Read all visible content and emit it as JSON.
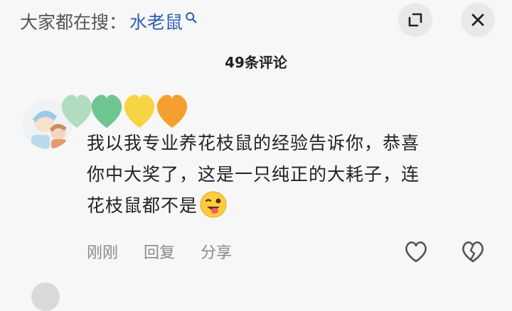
{
  "search": {
    "prefix": "大家都在搜：",
    "term": "水老鼠",
    "icon": "search-icon"
  },
  "header": {
    "expand_icon": "expand-icon",
    "close_icon": "close-icon"
  },
  "comments_header": {
    "count_label": "49条评论"
  },
  "comment": {
    "avatar_icon": "avatar",
    "heart_colors": [
      "#a8d8b9",
      "#66c28a",
      "#f5d23a",
      "#f59a23"
    ],
    "lines": [
      "我以我专业养花枝鼠的经验告诉你，恭喜",
      "你中大奖了，这是一只纯正的大耗子，连",
      "花枝鼠都不是"
    ],
    "emoji": "winking-face-tongue-icon",
    "actions": {
      "time": "刚刚",
      "reply": "回复",
      "share": "分享"
    },
    "like_icon": "heart-outline-icon",
    "dislike_icon": "broken-heart-icon"
  }
}
